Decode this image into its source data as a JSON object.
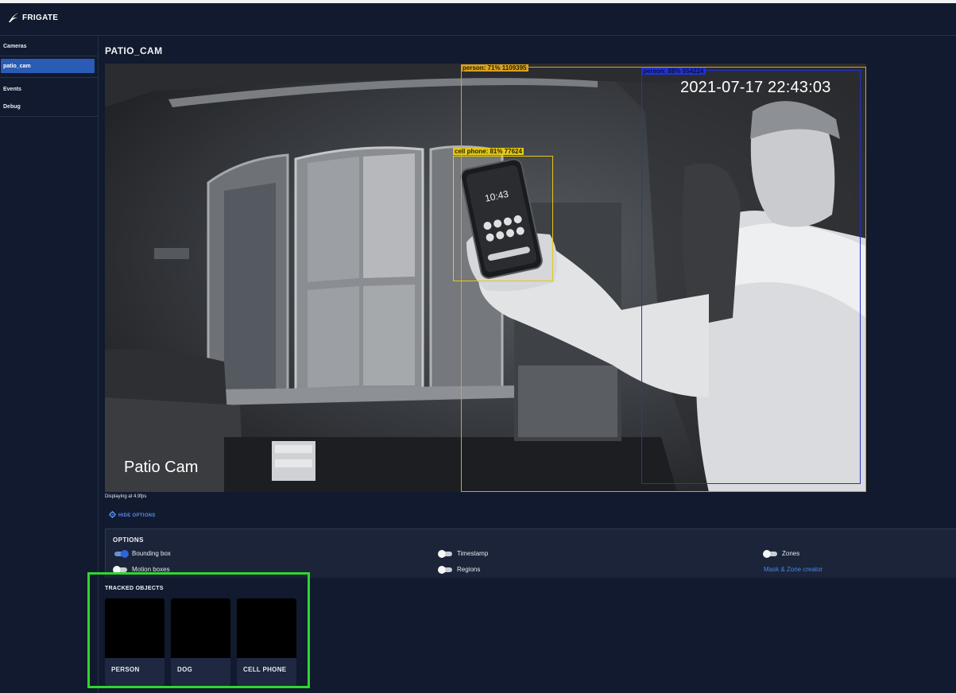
{
  "app": {
    "brand": "FRIGATE"
  },
  "sidebar": {
    "items": [
      {
        "label": "Cameras"
      },
      {
        "label": "patio_cam",
        "active": true
      },
      {
        "label": "Events"
      },
      {
        "label": "Debug"
      }
    ]
  },
  "main": {
    "title": "PATIO_CAM",
    "camera": {
      "timestamp": "2021-07-17 22:43:03",
      "name": "Patio Cam",
      "detections": [
        {
          "label": "person: 71% 1109395",
          "color": "#d9a321"
        },
        {
          "label": "person: 88% 554224",
          "color": "#2233cc"
        },
        {
          "label": "cell phone: 81% 77624",
          "color": "#e3c818"
        }
      ]
    },
    "fps_text": "Displaying at 4.9fps",
    "hide_options_label": "HIDE OPTIONS",
    "options": {
      "title": "OPTIONS",
      "toggles": [
        {
          "label": "Bounding box",
          "on": true
        },
        {
          "label": "Timestamp",
          "on": false
        },
        {
          "label": "Zones",
          "on": false
        },
        {
          "label": "Motion boxes",
          "on": false
        },
        {
          "label": "Regions",
          "on": false
        }
      ],
      "mask_link": "Mask & Zone creator"
    },
    "tracked_objects": {
      "title": "TRACKED OBJECTS",
      "items": [
        {
          "label": "PERSON"
        },
        {
          "label": "DOG"
        },
        {
          "label": "CELL PHONE"
        }
      ]
    }
  },
  "colors": {
    "background": "#111a2e",
    "accent": "#2a5bb5",
    "link": "#4a84ef",
    "highlight": "#2fd62f"
  }
}
